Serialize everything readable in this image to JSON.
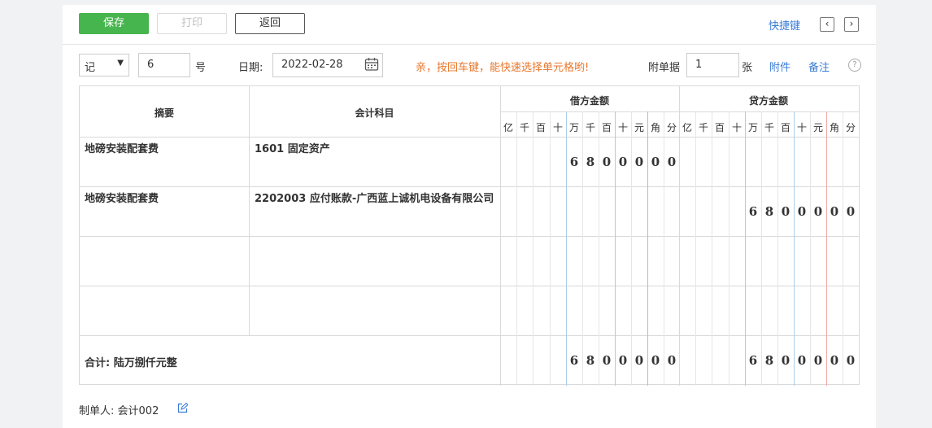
{
  "toolbar": {
    "save": "保存",
    "print": "打印",
    "back": "返回",
    "shortcut": "快捷键",
    "prev": "‹",
    "next": "›"
  },
  "header": {
    "voucher_type": "记",
    "voucher_no": "6",
    "no_suffix": "号",
    "date_label": "日期:",
    "date": "2022-02-28",
    "hint": "亲，按回车键，能快速选择单元格哟!",
    "attach_label": "附单据",
    "attach_count": "1",
    "attach_unit": "张",
    "attachment_link": "附件",
    "remark_link": "备注",
    "help": "?"
  },
  "table": {
    "col_summary": "摘要",
    "col_account": "会计科目",
    "col_debit": "借方金额",
    "col_credit": "贷方金额",
    "units": [
      "亿",
      "千",
      "百",
      "十",
      "万",
      "千",
      "百",
      "十",
      "元",
      "角",
      "分"
    ],
    "rows": [
      {
        "summary": "地磅安装配套费",
        "account": "1601 固定资产",
        "debit": [
          "",
          "",
          "",
          "",
          "6",
          "8",
          "0",
          "0",
          "0",
          "0",
          "0"
        ],
        "credit": [
          "",
          "",
          "",
          "",
          "",
          "",
          "",
          "",
          "",
          "",
          ""
        ]
      },
      {
        "summary": "地磅安装配套费",
        "account": "2202003 应付账款-广西蓝上诚机电设备有限公司",
        "debit": [
          "",
          "",
          "",
          "",
          "",
          "",
          "",
          "",
          "",
          "",
          ""
        ],
        "credit": [
          "",
          "",
          "",
          "",
          "6",
          "8",
          "0",
          "0",
          "0",
          "0",
          "0"
        ]
      },
      {
        "summary": "",
        "account": "",
        "debit": [
          "",
          "",
          "",
          "",
          "",
          "",
          "",
          "",
          "",
          "",
          ""
        ],
        "credit": [
          "",
          "",
          "",
          "",
          "",
          "",
          "",
          "",
          "",
          "",
          ""
        ]
      },
      {
        "summary": "",
        "account": "",
        "debit": [
          "",
          "",
          "",
          "",
          "",
          "",
          "",
          "",
          "",
          "",
          ""
        ],
        "credit": [
          "",
          "",
          "",
          "",
          "",
          "",
          "",
          "",
          "",
          "",
          ""
        ]
      }
    ],
    "total_label": "合计: 陆万捌仟元整",
    "total_debit": [
      "",
      "",
      "",
      "",
      "6",
      "8",
      "0",
      "0",
      "0",
      "0",
      "0"
    ],
    "total_credit": [
      "",
      "",
      "",
      "",
      "6",
      "8",
      "0",
      "0",
      "0",
      "0",
      "0"
    ]
  },
  "footer": {
    "maker_label": "制单人:",
    "maker": "会计002"
  }
}
